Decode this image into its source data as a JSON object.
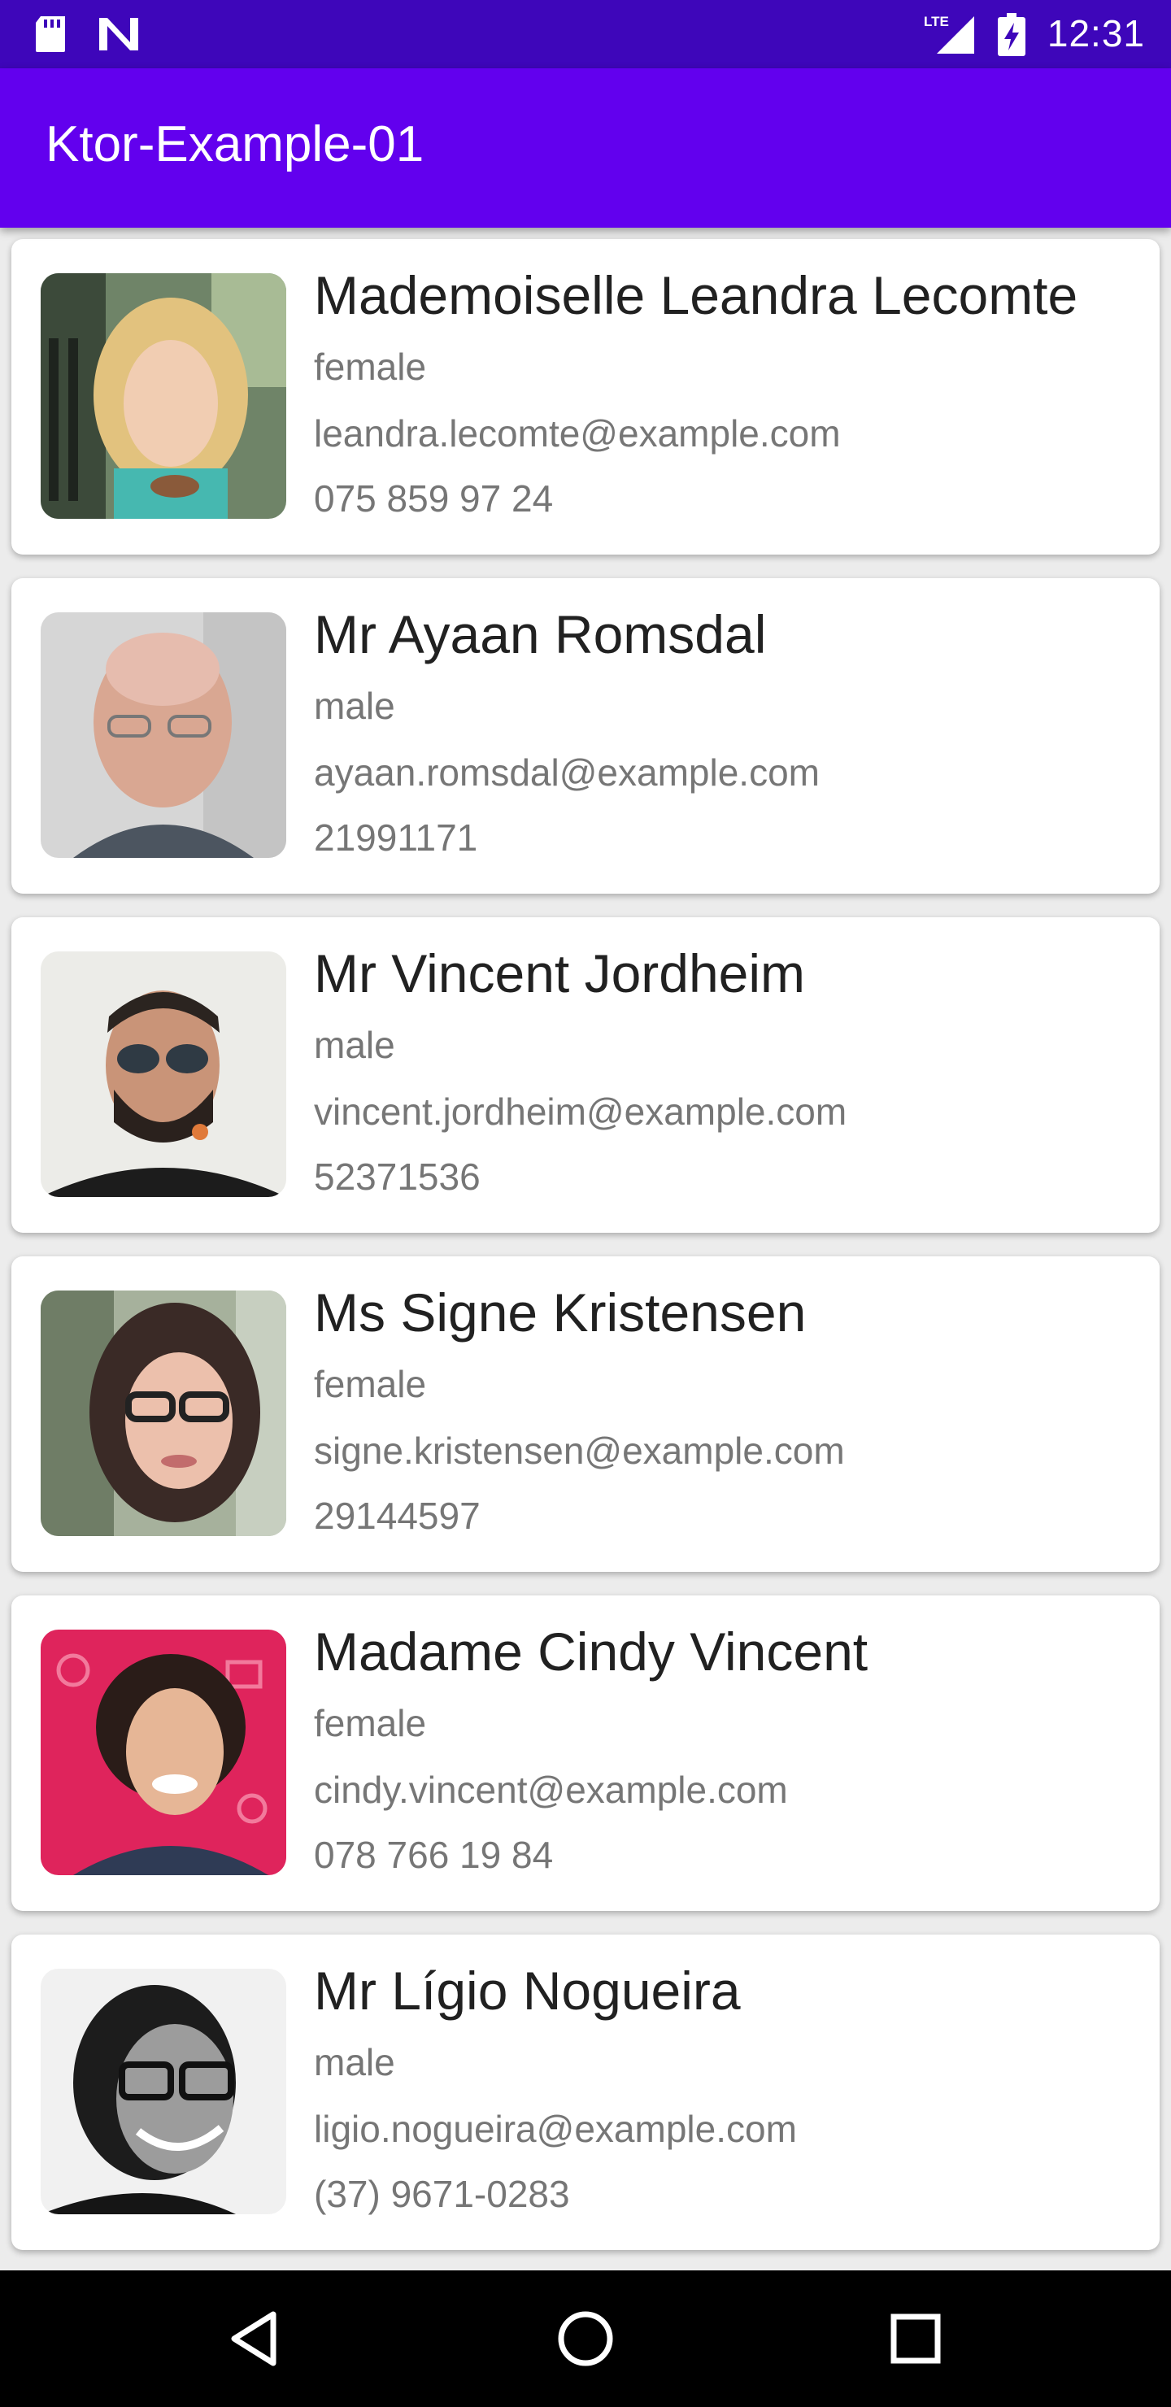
{
  "status_bar": {
    "time": "12:31",
    "network_label": "LTE",
    "icons": [
      "sd-card-icon",
      "n-notification-icon",
      "lte-signal-icon",
      "battery-charging-icon"
    ]
  },
  "app_bar": {
    "title": "Ktor-Example-01",
    "color": "#6200ee",
    "status_color": "#3e06ba"
  },
  "users": [
    {
      "name": "Mademoiselle Leandra Lecomte",
      "gender": "female",
      "email": "leandra.lecomte@example.com",
      "phone": "075 859 97 24",
      "photo_bg": "#7a8f70",
      "photo_subject": "#e9c98a"
    },
    {
      "name": "Mr Ayaan Romsdal",
      "gender": "male",
      "email": "ayaan.romsdal@example.com",
      "phone": "21991171",
      "photo_bg": "#d8d8d8",
      "photo_subject": "#d7a592"
    },
    {
      "name": "Mr Vincent Jordheim",
      "gender": "male",
      "email": "vincent.jordheim@example.com",
      "phone": "52371536",
      "photo_bg": "#eeeeea",
      "photo_subject": "#c99478"
    },
    {
      "name": "Ms Signe Kristensen",
      "gender": "female",
      "email": "signe.kristensen@example.com",
      "phone": "29144597",
      "photo_bg": "#a8b39e",
      "photo_subject": "#e6b8a4"
    },
    {
      "name": "Madame Cindy Vincent",
      "gender": "female",
      "email": "cindy.vincent@example.com",
      "phone": "078 766 19 84",
      "photo_bg": "#e0245e",
      "photo_subject": "#e8b99a"
    },
    {
      "name": "Mr Lígio Nogueira",
      "gender": "male",
      "email": "ligio.nogueira@example.com",
      "phone": "(37) 9671-0283",
      "photo_bg": "#f2f2f2",
      "photo_subject": "#9a9a9a"
    }
  ],
  "nav_bar": {
    "buttons": [
      "back-icon",
      "home-icon",
      "recents-icon"
    ]
  }
}
